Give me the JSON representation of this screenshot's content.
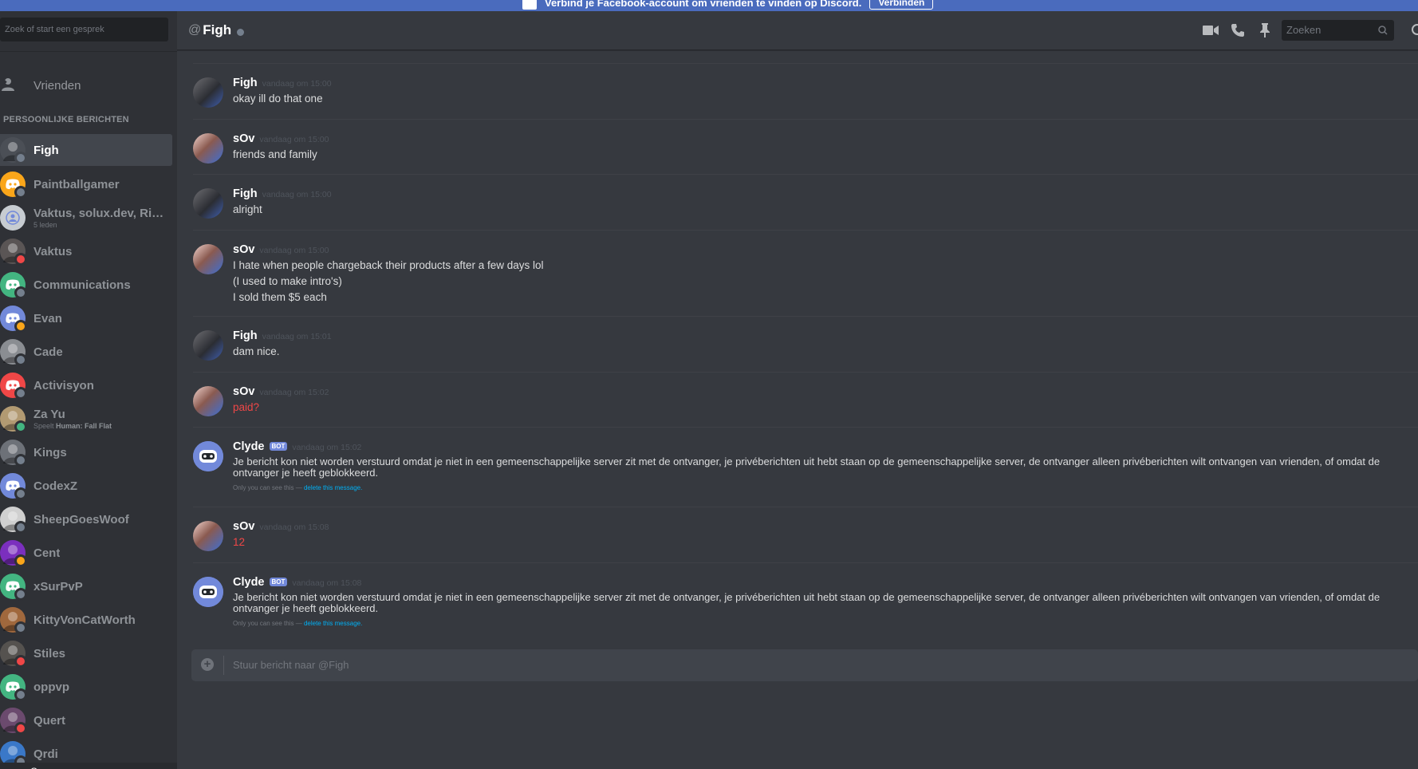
{
  "banner": {
    "text": "Verbind je Facebook-account om vrienden te vinden op Discord.",
    "button": "Verbinden",
    "color": "#4a6bbd"
  },
  "sidebar": {
    "search_placeholder": "Zoek of start een gesprek",
    "friends_label": "Vrienden",
    "section_title": "PERSOONLIJKE BERICHTEN",
    "dms": [
      {
        "name": "Figh",
        "sub": "",
        "active": true,
        "avatar": "photo",
        "avatar_color": "#4b4f56",
        "status": "#747f8d"
      },
      {
        "name": "Paintballgamer",
        "sub": "",
        "active": false,
        "avatar": "discord-logo-icon",
        "avatar_color": "#faa61a",
        "status": "#747f8d"
      },
      {
        "name": "Vaktus, solux.dev, River...",
        "sub": "5 leden",
        "active": false,
        "avatar": "group-icon",
        "avatar_color": "#c7ccd1",
        "status": ""
      },
      {
        "name": "Vaktus",
        "sub": "",
        "active": false,
        "avatar": "photo",
        "avatar_color": "#5a5555",
        "status": "#f04747"
      },
      {
        "name": "Communications",
        "sub": "",
        "active": false,
        "avatar": "discord-logo-icon",
        "avatar_color": "#43b581",
        "status": "#747f8d"
      },
      {
        "name": "Evan",
        "sub": "",
        "active": false,
        "avatar": "discord-logo-icon",
        "avatar_color": "#7289da",
        "status": "#faa61a"
      },
      {
        "name": "Cade",
        "sub": "",
        "active": false,
        "avatar": "photo",
        "avatar_color": "#8a8d92",
        "status": "#747f8d"
      },
      {
        "name": "Activisyon",
        "sub": "",
        "active": false,
        "avatar": "discord-logo-icon",
        "avatar_color": "#f04747",
        "status": "#747f8d"
      },
      {
        "name": "Za Yu",
        "sub_prefix": "Speelt",
        "sub_game": "Human: Fall Flat",
        "active": false,
        "avatar": "photo",
        "avatar_color": "#b29a72",
        "status": "#43b581"
      },
      {
        "name": "Kings",
        "sub": "",
        "active": false,
        "avatar": "photo",
        "avatar_color": "#6d7178",
        "status": "#747f8d"
      },
      {
        "name": "CodexZ",
        "sub": "",
        "active": false,
        "avatar": "discord-logo-icon",
        "avatar_color": "#7289da",
        "status": "#747f8d"
      },
      {
        "name": "SheepGoesWoof",
        "sub": "",
        "active": false,
        "avatar": "photo",
        "avatar_color": "#d0d0d0",
        "status": "#747f8d"
      },
      {
        "name": "Cent",
        "sub": "",
        "active": false,
        "avatar": "photo",
        "avatar_color": "#7b2fbe",
        "status": "#faa61a"
      },
      {
        "name": "xSurPvP",
        "sub": "",
        "active": false,
        "avatar": "discord-logo-icon",
        "avatar_color": "#43b581",
        "status": "#747f8d"
      },
      {
        "name": "KittyVonCatWorth",
        "sub": "",
        "active": false,
        "avatar": "photo",
        "avatar_color": "#a0683d",
        "status": "#747f8d"
      },
      {
        "name": "Stiles",
        "sub": "",
        "active": false,
        "avatar": "photo",
        "avatar_color": "#55524f",
        "status": "#f04747"
      },
      {
        "name": "oppvp",
        "sub": "",
        "active": false,
        "avatar": "discord-logo-icon",
        "avatar_color": "#43b581",
        "status": "#747f8d"
      },
      {
        "name": "Quert",
        "sub": "",
        "active": false,
        "avatar": "photo",
        "avatar_color": "#6b4a6e",
        "status": "#f04747"
      },
      {
        "name": "Qrdi",
        "sub": "",
        "active": false,
        "avatar": "photo",
        "avatar_color": "#3a78c8",
        "status": "#747f8d"
      }
    ],
    "current_user": "sOv"
  },
  "header": {
    "at": "@",
    "channel_name": "Figh",
    "search_placeholder": "Zoeken",
    "icons": [
      "video-icon",
      "phone-icon",
      "pin-icon",
      "add-friend-icon"
    ]
  },
  "messages": [
    {
      "author": "Figh",
      "bot": false,
      "time": "vandaag om 15:00",
      "avatar": "figh",
      "lines": [
        "okay ill do that one"
      ],
      "red": false
    },
    {
      "author": "sOv",
      "bot": false,
      "time": "vandaag om 15:00",
      "avatar": "sov",
      "lines": [
        "friends and family"
      ],
      "red": false
    },
    {
      "author": "Figh",
      "bot": false,
      "time": "vandaag om 15:00",
      "avatar": "figh",
      "lines": [
        "alright"
      ],
      "red": false
    },
    {
      "author": "sOv",
      "bot": false,
      "time": "vandaag om 15:00",
      "avatar": "sov",
      "lines": [
        "I hate when people chargeback their products after a few days lol",
        "(I used to make intro's)",
        "I sold them $5 each"
      ],
      "red": false
    },
    {
      "author": "Figh",
      "bot": false,
      "time": "vandaag om 15:01",
      "avatar": "figh",
      "lines": [
        "dam nice."
      ],
      "red": false
    },
    {
      "author": "sOv",
      "bot": false,
      "time": "vandaag om 15:02",
      "avatar": "sov",
      "lines": [
        "paid?"
      ],
      "red": true
    },
    {
      "author": "Clyde",
      "bot": true,
      "bot_tag": "BOT",
      "time": "vandaag om 15:02",
      "avatar": "clyde",
      "lines": [
        "Je bericht kon niet worden verstuurd omdat je niet in een gemeenschappelijke server zit met de ontvanger, je privéberichten uit hebt staan op de gemeenschappelijke server, de ontvanger alleen privéberichten wilt ontvangen van vrienden, of omdat de ontvanger je heeft geblokkeerd."
      ],
      "ephemeral": "Only you can see this —",
      "ephemeral_link": "delete this message."
    },
    {
      "author": "sOv",
      "bot": false,
      "time": "vandaag om 15:08",
      "avatar": "sov",
      "lines": [
        "12"
      ],
      "red": true
    },
    {
      "author": "Clyde",
      "bot": true,
      "bot_tag": "BOT",
      "time": "vandaag om 15:08",
      "avatar": "clyde",
      "lines": [
        "Je bericht kon niet worden verstuurd omdat je niet in een gemeenschappelijke server zit met de ontvanger, je privéberichten uit hebt staan op de gemeenschappelijke server, de ontvanger alleen privéberichten wilt ontvangen van vrienden, of omdat de ontvanger je heeft geblokkeerd."
      ],
      "ephemeral": "Only you can see this —",
      "ephemeral_link": "delete this message."
    }
  ],
  "composer": {
    "placeholder": "Stuur bericht naar @Figh"
  }
}
